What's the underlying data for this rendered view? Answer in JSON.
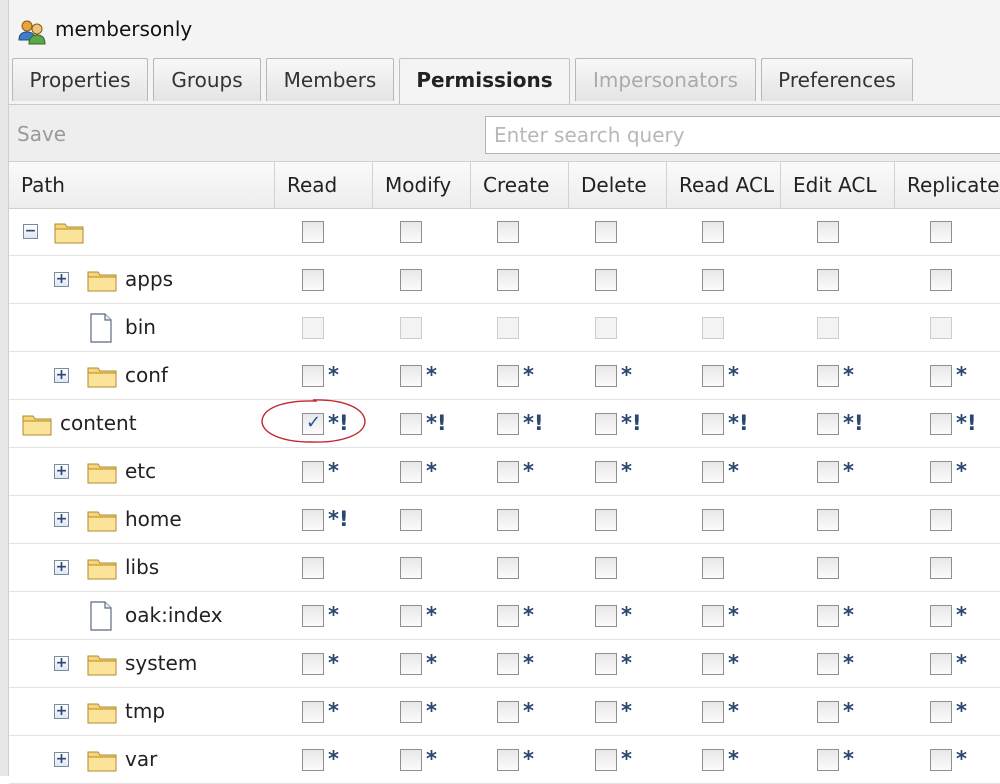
{
  "window": {
    "title": "membersonly"
  },
  "tabs": [
    {
      "label": "Properties",
      "state": "normal"
    },
    {
      "label": "Groups",
      "state": "normal"
    },
    {
      "label": "Members",
      "state": "normal"
    },
    {
      "label": "Permissions",
      "state": "active"
    },
    {
      "label": "Impersonators",
      "state": "disabled"
    },
    {
      "label": "Preferences",
      "state": "normal"
    }
  ],
  "toolbar": {
    "save_label": "Save",
    "search_placeholder": "Enter search query"
  },
  "columns": [
    "Path",
    "Read",
    "Modify",
    "Create",
    "Delete",
    "Read ACL",
    "Edit ACL",
    "Replicate"
  ],
  "rows": [
    {
      "name": "",
      "expander": "minus",
      "icon": "folder-icon",
      "checked": [
        false,
        false,
        false,
        false,
        false,
        false,
        false
      ],
      "marks": [
        "",
        "",
        "",
        "",
        "",
        "",
        ""
      ],
      "disabled": false
    },
    {
      "name": "apps",
      "expander": "plus",
      "icon": "folder-icon",
      "checked": [
        false,
        false,
        false,
        false,
        false,
        false,
        false
      ],
      "marks": [
        "",
        "",
        "",
        "",
        "",
        "",
        ""
      ],
      "disabled": false
    },
    {
      "name": "bin",
      "expander": "",
      "icon": "file-icon",
      "checked": [
        false,
        false,
        false,
        false,
        false,
        false,
        false
      ],
      "marks": [
        "",
        "",
        "",
        "",
        "",
        "",
        ""
      ],
      "disabled": true
    },
    {
      "name": "conf",
      "expander": "plus",
      "icon": "folder-icon",
      "checked": [
        false,
        false,
        false,
        false,
        false,
        false,
        false
      ],
      "marks": [
        "*",
        "*",
        "*",
        "*",
        "*",
        "*",
        "*"
      ],
      "disabled": false
    },
    {
      "name": "content",
      "expander": "",
      "icon": "folder-icon",
      "checked": [
        true,
        false,
        false,
        false,
        false,
        false,
        false
      ],
      "marks": [
        "*!",
        "*!",
        "*!",
        "*!",
        "*!",
        "*!",
        "*!"
      ],
      "disabled": false
    },
    {
      "name": "etc",
      "expander": "plus",
      "icon": "folder-icon",
      "checked": [
        false,
        false,
        false,
        false,
        false,
        false,
        false
      ],
      "marks": [
        "*",
        "*",
        "*",
        "*",
        "*",
        "*",
        "*"
      ],
      "disabled": false
    },
    {
      "name": "home",
      "expander": "plus",
      "icon": "folder-icon",
      "checked": [
        false,
        false,
        false,
        false,
        false,
        false,
        false
      ],
      "marks": [
        "*!",
        "",
        "",
        "",
        "",
        "",
        ""
      ],
      "disabled": false
    },
    {
      "name": "libs",
      "expander": "plus",
      "icon": "folder-icon",
      "checked": [
        false,
        false,
        false,
        false,
        false,
        false,
        false
      ],
      "marks": [
        "",
        "",
        "",
        "",
        "",
        "",
        ""
      ],
      "disabled": false
    },
    {
      "name": "oak:index",
      "expander": "",
      "icon": "file-icon",
      "checked": [
        false,
        false,
        false,
        false,
        false,
        false,
        false
      ],
      "marks": [
        "*",
        "*",
        "*",
        "*",
        "*",
        "*",
        "*"
      ],
      "disabled": false
    },
    {
      "name": "system",
      "expander": "plus",
      "icon": "folder-icon",
      "checked": [
        false,
        false,
        false,
        false,
        false,
        false,
        false
      ],
      "marks": [
        "*",
        "*",
        "*",
        "*",
        "*",
        "*",
        "*"
      ],
      "disabled": false
    },
    {
      "name": "tmp",
      "expander": "plus",
      "icon": "folder-icon",
      "checked": [
        false,
        false,
        false,
        false,
        false,
        false,
        false
      ],
      "marks": [
        "*",
        "*",
        "*",
        "*",
        "*",
        "*",
        "*"
      ],
      "disabled": false
    },
    {
      "name": "var",
      "expander": "plus",
      "icon": "folder-icon",
      "checked": [
        false,
        false,
        false,
        false,
        false,
        false,
        false
      ],
      "marks": [
        "*",
        "*",
        "*",
        "*",
        "*",
        "*",
        "*"
      ],
      "disabled": false
    }
  ],
  "colors": {
    "mark": "#2b4770",
    "check": "#2b4f9a",
    "annotation": "#c0282e"
  }
}
